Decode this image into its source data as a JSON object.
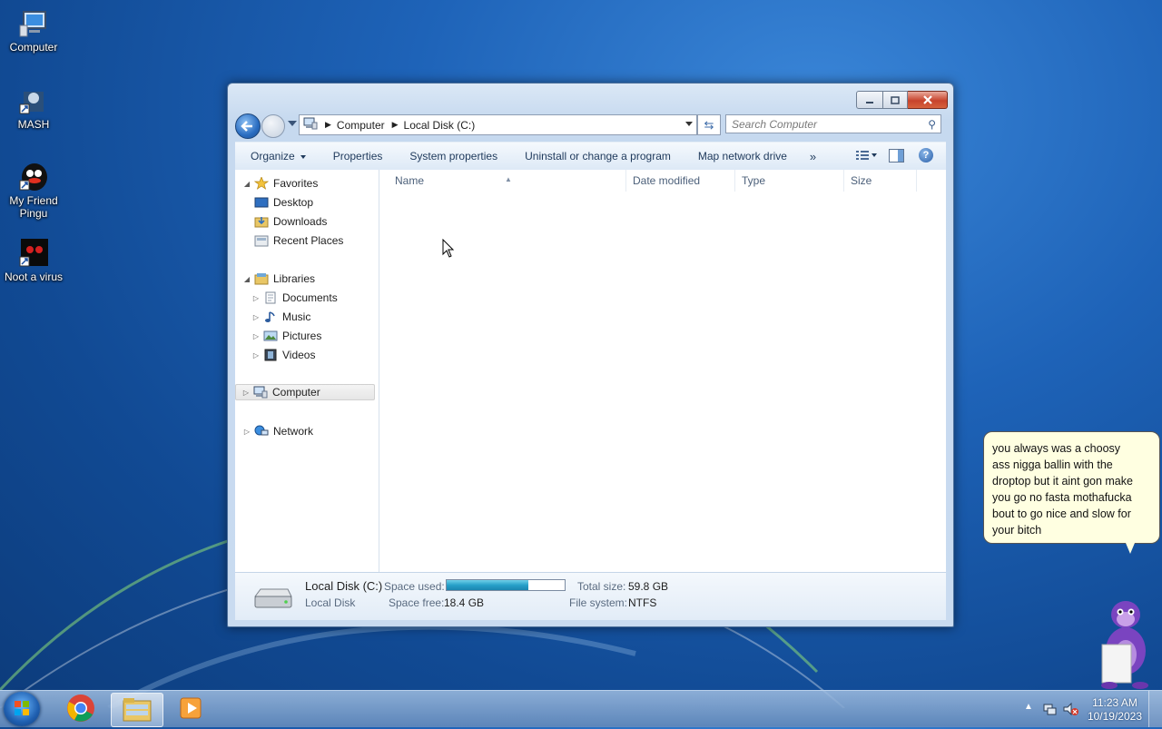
{
  "desktop": {
    "icons": [
      {
        "label": "Computer"
      },
      {
        "label": "MASH"
      },
      {
        "label": "My Friend Pingu"
      },
      {
        "label": "Noot a virus"
      }
    ]
  },
  "explorer": {
    "address": {
      "segments": [
        "Computer",
        "Local Disk (C:)"
      ]
    },
    "search": {
      "placeholder": "Search Computer"
    },
    "command_bar": {
      "organize": "Organize",
      "properties": "Properties",
      "system_properties": "System properties",
      "uninstall": "Uninstall or change a program",
      "map_network_drive": "Map network drive",
      "more": "»"
    },
    "nav_pane": {
      "favorites": {
        "label": "Favorites",
        "items": [
          "Desktop",
          "Downloads",
          "Recent Places"
        ]
      },
      "libraries": {
        "label": "Libraries",
        "items": [
          "Documents",
          "Music",
          "Pictures",
          "Videos"
        ]
      },
      "computer": "Computer",
      "network": "Network"
    },
    "columns": [
      "Name",
      "Date modified",
      "Type",
      "Size"
    ],
    "details": {
      "name": "Local Disk (C:)",
      "kind": "Local Disk",
      "space_used_label": "Space used:",
      "space_used_fraction": 0.69,
      "space_free_label": "Space free:",
      "space_free": "18.4 GB",
      "total_size_label": "Total size:",
      "total_size": "59.8 GB",
      "file_system_label": "File system:",
      "file_system": "NTFS"
    }
  },
  "speech_bubble": {
    "lines": [
      "you always was a choosy",
      "ass nigga ballin with the",
      "droptop but it aint gon make",
      "you go no fasta mothafucka",
      "bout to go nice and slow for",
      "your bitch"
    ]
  },
  "taskbar": {
    "apps": [
      "chrome-icon",
      "explorer-icon",
      "media-player-icon"
    ],
    "clock": {
      "time": "11:23 AM",
      "date": "10/19/2023"
    }
  }
}
